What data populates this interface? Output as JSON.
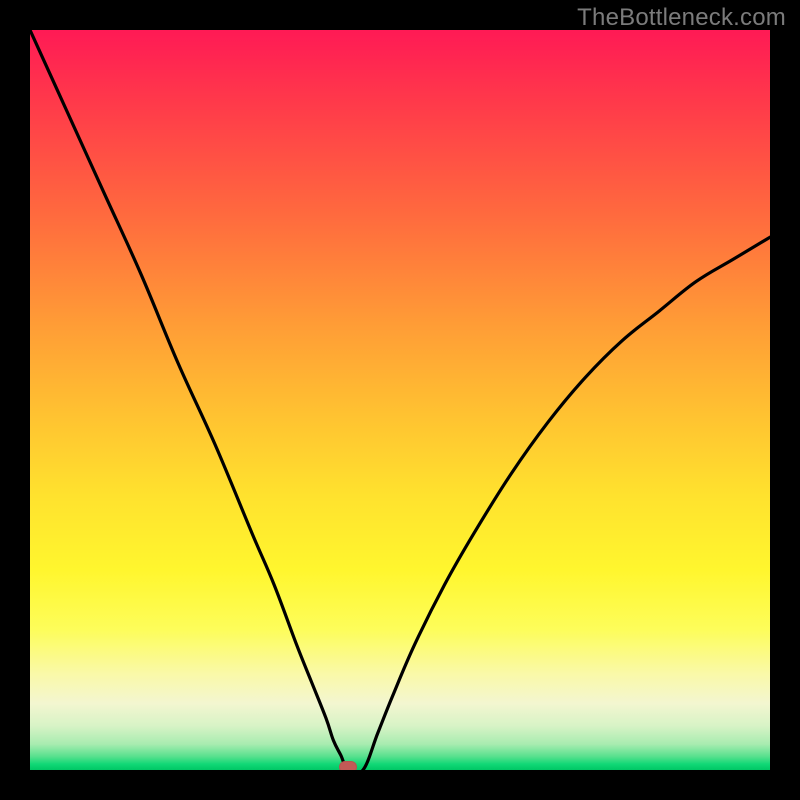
{
  "watermark": "TheBottleneck.com",
  "colors": {
    "frame_bg": "#000000",
    "curve": "#000000",
    "marker": "#c25a56",
    "watermark": "#7b7b7b"
  },
  "chart_data": {
    "type": "line",
    "title": "",
    "xlabel": "",
    "ylabel": "",
    "xlim": [
      0,
      100
    ],
    "ylim": [
      0,
      100
    ],
    "grid": false,
    "legend": false,
    "annotations": [
      {
        "kind": "marker",
        "x": 43,
        "y": 0
      }
    ],
    "series": [
      {
        "name": "curve-left",
        "x": [
          0,
          5,
          10,
          15,
          20,
          25,
          30,
          33,
          36,
          38,
          40,
          41,
          42,
          43
        ],
        "values": [
          100,
          89,
          78,
          67,
          55,
          44,
          32,
          25,
          17,
          12,
          7,
          4,
          2,
          0
        ]
      },
      {
        "name": "floor",
        "x": [
          43,
          45
        ],
        "values": [
          0,
          0
        ]
      },
      {
        "name": "curve-right",
        "x": [
          45,
          47,
          49,
          52,
          56,
          60,
          65,
          70,
          75,
          80,
          85,
          90,
          95,
          100
        ],
        "values": [
          0,
          5,
          10,
          17,
          25,
          32,
          40,
          47,
          53,
          58,
          62,
          66,
          69,
          72
        ]
      }
    ]
  }
}
